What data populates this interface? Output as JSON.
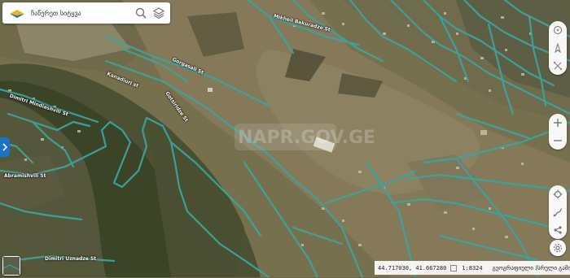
{
  "search": {
    "placeholder": "ჩაწერეთ სიტყვა"
  },
  "bottom_bar": {
    "coordinates": "44.717030, 41.667280",
    "scale": "1:8324",
    "layer_label": "გეოგრაფიული (სრული გამოჩენა)"
  },
  "street_labels": {
    "label_1": "Gorgasali St",
    "label_2": "Mikheil Bakuradze St",
    "label_3": "Kanadiuri st",
    "label_4": "Gotsiridze St",
    "label_5": "Abramishvili St",
    "label_6": "Dimitri Uznadze St",
    "label_7": "Dimitri Mindiashvili St"
  },
  "watermark": "NAPR.GOV.GE",
  "colors": {
    "road": "#3ba4a0",
    "accent": "#1a73c8"
  },
  "icons": [
    "search-icon",
    "layers-icon",
    "compass-icon",
    "target-icon",
    "measure-icon",
    "zoom-in-icon",
    "zoom-out-icon",
    "locate-icon",
    "route-icon",
    "share-icon",
    "settings-icon",
    "expand-icon"
  ]
}
